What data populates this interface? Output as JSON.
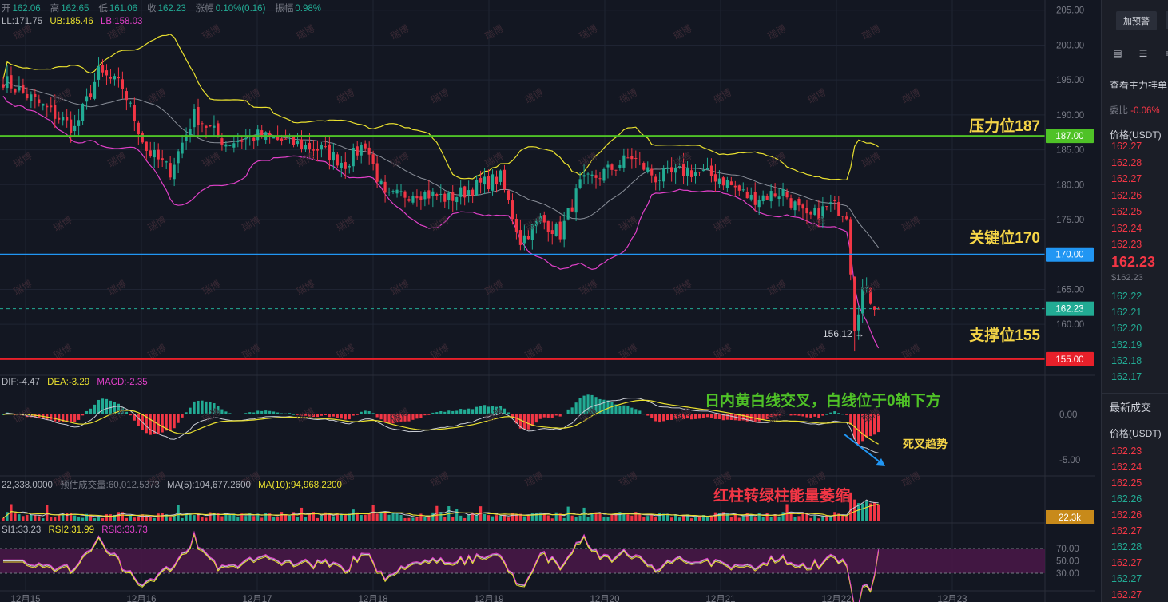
{
  "header": {
    "ohlc": [
      {
        "label": "开",
        "value": "162.06"
      },
      {
        "label": "高",
        "value": "162.65"
      },
      {
        "label": "低",
        "value": "161.06"
      },
      {
        "label": "收",
        "value": "162.23"
      },
      {
        "label": "涨幅",
        "value": "0.10%(0.16)"
      },
      {
        "label": "振幅",
        "value": "0.98%"
      }
    ],
    "boll": {
      "mid": "LL:171.75",
      "ub": "UB:185.46",
      "lb": "LB:158.03"
    }
  },
  "indicators": {
    "macd": {
      "dif": "DIF:-4.47",
      "dea": "DEA:-3.29",
      "macd": "MACD:-2.35"
    },
    "volume": {
      "vol": "22,338.0000",
      "est": "预估成交量:60,012.5373",
      "ma5": "MA(5):104,677.2600",
      "ma10": "MA(10):94,968.2200"
    },
    "rsi": {
      "rsi1": "SI1:33.23",
      "rsi2": "RSI2:31.99",
      "rsi3": "RSI3:33.73"
    }
  },
  "annotations": {
    "resistance": "压力位187",
    "key": "关键位170",
    "support": "支撑位155",
    "macd_note": "日内黄白线交叉，白线位于0轴下方",
    "death_cross": "死叉趋势",
    "volume_note": "红柱转绿柱能量萎缩",
    "low_mark": "156.12 →",
    "watermark": "瑞博"
  },
  "levels": [
    {
      "name": "resistance",
      "price": 187,
      "label": "187.00",
      "color": "#4fc227"
    },
    {
      "name": "key",
      "price": 170,
      "label": "170.00",
      "color": "#2196f3"
    },
    {
      "name": "support",
      "price": 155,
      "label": "155.00",
      "color": "#e8202a"
    }
  ],
  "last_price": {
    "value": 162.23,
    "label": "162.23"
  },
  "volume_tag": "22.3k",
  "colors": {
    "up": "#22ab94",
    "down": "#f23645",
    "boll_band": "#e9e02f",
    "boll_lower": "#e040c8",
    "boll_mid": "#8a8f99",
    "annotation_yellow": "#f5d547",
    "annotation_green": "#4fc227",
    "annotation_red": "#f23645",
    "arrow_blue": "#2196f3"
  },
  "chart_data": {
    "type": "candlestick",
    "symbol_unit": "USDT",
    "x_labels": [
      "12月15",
      "12月16",
      "12月17",
      "12月18",
      "12月19",
      "12月20",
      "12月21",
      "12月22",
      "12月23"
    ],
    "price_ticks": [
      "205.00",
      "200.00",
      "195.00",
      "190.00",
      "185.00",
      "180.00",
      "175.00",
      "165.00",
      "160.00"
    ],
    "macd_ticks": [
      "0.00",
      "-5.00"
    ],
    "rsi_ticks": [
      "70.00",
      "50.00",
      "30.00"
    ],
    "ylim": [
      153.5,
      206
    ],
    "anchors": [
      {
        "t": 0,
        "p": 195
      },
      {
        "t": 8,
        "p": 192
      },
      {
        "t": 18,
        "p": 188
      },
      {
        "t": 24,
        "p": 196
      },
      {
        "t": 30,
        "p": 194
      },
      {
        "t": 36,
        "p": 185
      },
      {
        "t": 42,
        "p": 182
      },
      {
        "t": 48,
        "p": 190
      },
      {
        "t": 56,
        "p": 186
      },
      {
        "t": 64,
        "p": 187
      },
      {
        "t": 72,
        "p": 186
      },
      {
        "t": 80,
        "p": 185
      },
      {
        "t": 86,
        "p": 183
      },
      {
        "t": 91,
        "p": 186
      },
      {
        "t": 96,
        "p": 178
      },
      {
        "t": 104,
        "p": 179
      },
      {
        "t": 112,
        "p": 178
      },
      {
        "t": 120,
        "p": 180
      },
      {
        "t": 125,
        "p": 181
      },
      {
        "t": 130,
        "p": 172
      },
      {
        "t": 135,
        "p": 175
      },
      {
        "t": 140,
        "p": 173
      },
      {
        "t": 145,
        "p": 180
      },
      {
        "t": 152,
        "p": 182
      },
      {
        "t": 158,
        "p": 184
      },
      {
        "t": 164,
        "p": 181
      },
      {
        "t": 172,
        "p": 182
      },
      {
        "t": 180,
        "p": 181
      },
      {
        "t": 188,
        "p": 178
      },
      {
        "t": 196,
        "p": 179
      },
      {
        "t": 202,
        "p": 175
      },
      {
        "t": 208,
        "p": 177
      },
      {
        "t": 212,
        "p": 176
      },
      {
        "t": 214,
        "p": 160
      },
      {
        "t": 216,
        "p": 165
      },
      {
        "t": 220,
        "p": 162.2
      }
    ],
    "notable": {
      "high_area": 199.5,
      "low_marked": 156.12,
      "last": 162.23
    }
  },
  "right_panel": {
    "alert_button": "加预警",
    "main_orders": "查看主力挂单",
    "ratio_label": "委比",
    "ratio_value": "-0.06%",
    "price_header": "价格(USDT)",
    "asks": [
      "162.27",
      "162.28",
      "162.27",
      "162.26",
      "162.25",
      "162.24",
      "162.23"
    ],
    "last": "162.23",
    "last_sub": "$162.23",
    "bids": [
      "162.22",
      "162.21",
      "162.20",
      "162.19",
      "162.18",
      "162.17"
    ],
    "trades_title": "最新成交",
    "trades_header": "价格(USDT)",
    "trades": [
      {
        "p": "162.23",
        "c": "red"
      },
      {
        "p": "162.24",
        "c": "red"
      },
      {
        "p": "162.25",
        "c": "red"
      },
      {
        "p": "162.26",
        "c": "green"
      },
      {
        "p": "162.26",
        "c": "red"
      },
      {
        "p": "162.27",
        "c": "red"
      },
      {
        "p": "162.28",
        "c": "green"
      },
      {
        "p": "162.27",
        "c": "red"
      },
      {
        "p": "162.27",
        "c": "green"
      },
      {
        "p": "162.27",
        "c": "red"
      }
    ]
  }
}
